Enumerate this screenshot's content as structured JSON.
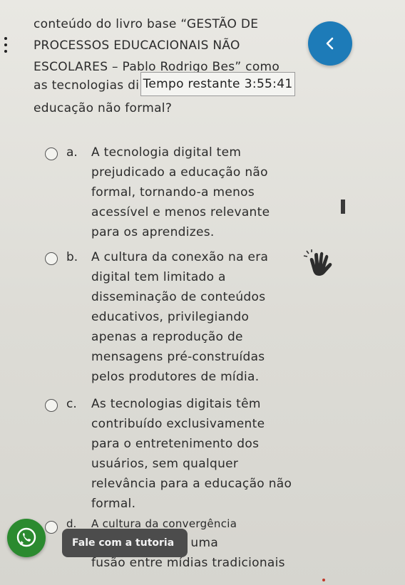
{
  "question": {
    "lines": [
      "conteúdo do livro base “GESTÃO DE",
      "PROCESSOS EDUCACIONAIS NÃO",
      "ESCOLARES – Pablo Rodrigo Bes” como",
      "as tecnologias di",
      "educação não formal?"
    ]
  },
  "timer": {
    "label": "Tempo restante",
    "value": "3:55:41"
  },
  "options": [
    {
      "letter": "a.",
      "lines": [
        "A tecnologia digital tem",
        "prejudicado a educação não",
        "formal, tornando-a menos",
        "acessível e menos relevante",
        "para os aprendizes."
      ]
    },
    {
      "letter": "b.",
      "lines": [
        "A cultura da conexão na era",
        "digital tem limitado a",
        "disseminação de conteúdos",
        "educativos, privilegiando",
        "apenas a reprodução de",
        "mensagens pré-construídas",
        "pelos produtores de mídia."
      ]
    },
    {
      "letter": "c.",
      "lines": [
        "As tecnologias digitais têm",
        "contribuído exclusivamente",
        "para o entretenimento dos",
        "usuários, sem qualquer",
        "relevância para a educação não",
        "formal."
      ]
    },
    {
      "letter": "d.",
      "lines": [
        "A cultura da convergência",
        "tem promovido uma",
        "fusão entre mídias tradicionais"
      ]
    }
  ],
  "chat": {
    "label": "Fale com a tutoria"
  },
  "icons": {
    "back": "chevron-left-icon",
    "menu": "kebab-menu-icon",
    "accessibility": "hand-talk-icon",
    "chat": "whatsapp-icon"
  },
  "colors": {
    "accent": "#1d7bb8",
    "chat": "#2b8a2f"
  }
}
